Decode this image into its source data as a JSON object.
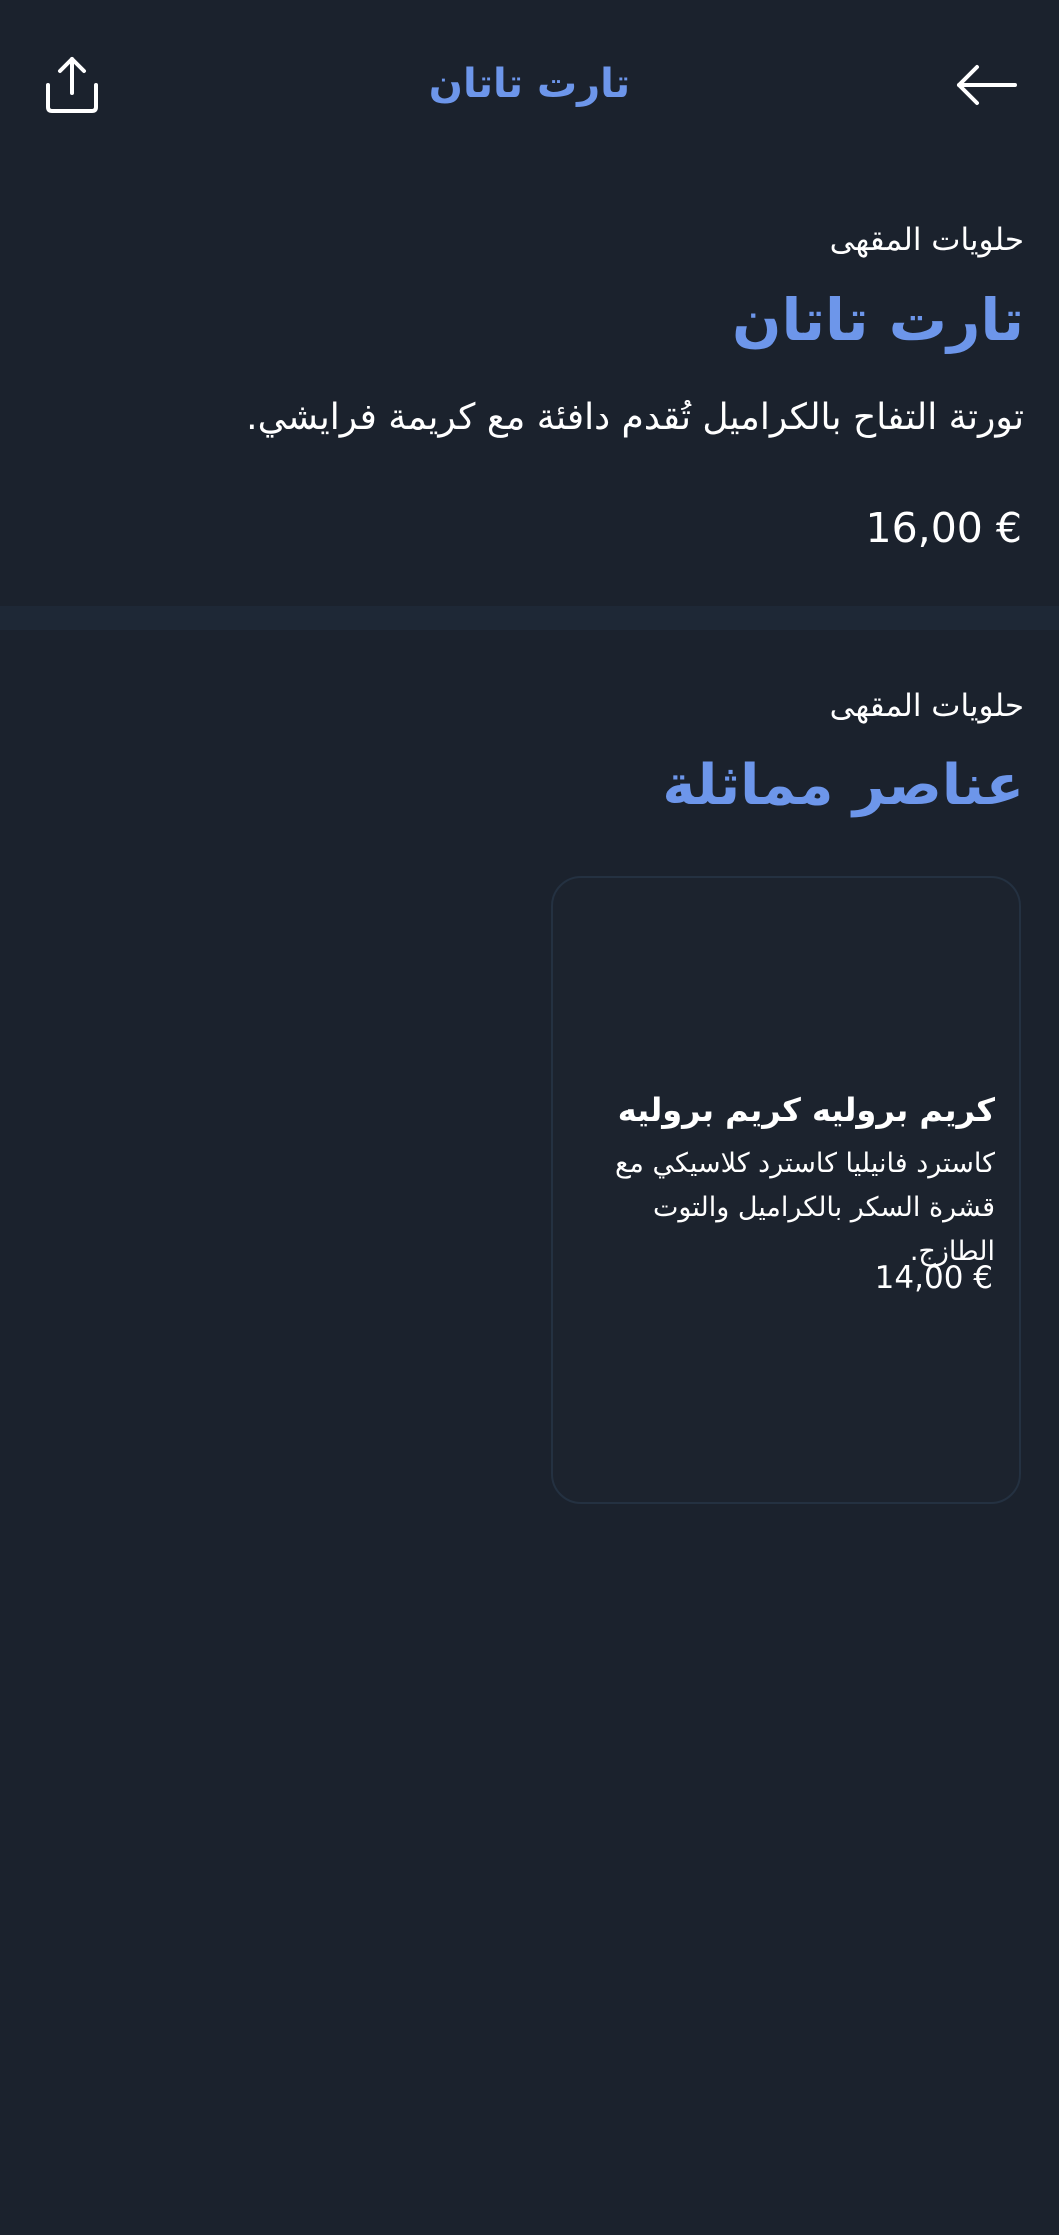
{
  "header": {
    "title": "تارت تاتان",
    "share_icon": "share-icon",
    "back_icon": "arrow-back-icon"
  },
  "product": {
    "category": "حلويات المقهى",
    "title": "تارت تاتان",
    "description": "تورتة التفاح بالكراميل تُقدم دافئة مع كريمة فرايشي.",
    "price": "16,00 €"
  },
  "similar": {
    "category": "حلويات المقهى",
    "title": "عناصر مماثلة",
    "items": [
      {
        "title": "كريم بروليه كريم بروليه",
        "description": "كاسترد فانيليا كاسترد كلاسيكي مع قشرة السكر بالكراميل والتوت الطازج.",
        "price": "14,00 €"
      }
    ]
  },
  "colors": {
    "background": "#1b222d",
    "accent": "#6d96ea",
    "divider": "#1e2836",
    "card_border": "#243141"
  }
}
